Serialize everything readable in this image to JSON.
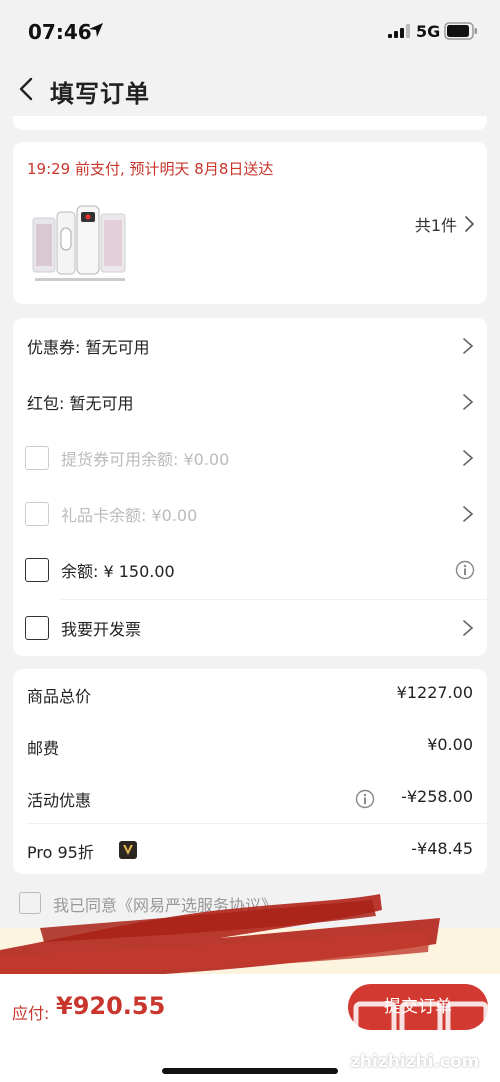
{
  "status_bar": {
    "time": "07:46",
    "network": "5G"
  },
  "nav": {
    "title": "填写订单"
  },
  "delivery": {
    "message": "19:29 前支付, 预计明天 8月8日送达",
    "item_count": "共1件"
  },
  "options": {
    "coupon": "优惠券: 暂无可用",
    "red_packet": "红包: 暂无可用",
    "pickup_voucher": "提货券可用余额: ¥0.00",
    "gift_card": "礼品卡余额: ¥0.00",
    "balance": "余额: ¥ 150.00",
    "invoice": "我要开发票"
  },
  "prices": {
    "items": [
      {
        "label": "商品总价",
        "value": "¥1227.00"
      },
      {
        "label": "邮费",
        "value": "¥0.00"
      },
      {
        "label": "活动优惠",
        "value": "-¥258.00"
      },
      {
        "label": "Pro 95折",
        "value": "-¥48.45"
      }
    ]
  },
  "agreement": {
    "text": "我已同意《网易严选服务协议》"
  },
  "footer": {
    "pay_label": "应付:",
    "pay_amount": "¥920.55",
    "submit_label": "提交订单",
    "watermark": "zhizhizhi.com"
  },
  "colors": {
    "accent_red": "#c8362d",
    "button_red": "#d23a31",
    "scribble_red": "#b3281e"
  },
  "icons": [
    "location-arrow-icon",
    "signal-icon",
    "battery-icon",
    "back-chevron-icon",
    "chevron-right-icon",
    "info-icon",
    "pro-v-icon"
  ]
}
